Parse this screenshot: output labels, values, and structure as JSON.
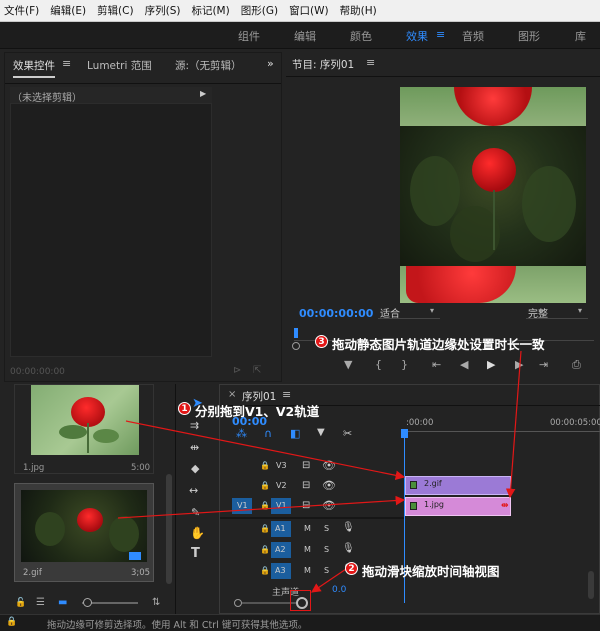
{
  "menu": [
    "文件(F)",
    "编辑(E)",
    "剪辑(C)",
    "序列(S)",
    "标记(M)",
    "图形(G)",
    "窗口(W)",
    "帮助(H)"
  ],
  "workspaces": [
    "组件",
    "编辑",
    "颜色",
    "效果",
    "音频",
    "图形",
    "库"
  ],
  "workspace_active": "效果",
  "effect_controls": {
    "tab1": "效果控件",
    "tab2": "Lumetri 范围",
    "tab3": "源:（无剪辑）",
    "no_clip": "（未选择剪辑）",
    "timecode": "00:00:00:00"
  },
  "program": {
    "title": "节目: 序列01",
    "timecode": "00:00:00:00",
    "fit": "适合",
    "quality": "完整"
  },
  "project": {
    "items": [
      {
        "name": "1.jpg",
        "duration": "5:00"
      },
      {
        "name": "2.gif",
        "duration": "3;05"
      }
    ]
  },
  "timeline": {
    "tab": "序列01",
    "timecode": "00:00",
    "ruler_start": ":00:00",
    "ruler_end": "00:00:05:00",
    "tracks": {
      "v3": "V3",
      "v2": "V2",
      "v1": "V1",
      "v1_source": "V1",
      "a1": "A1",
      "a2": "A2",
      "a3": "A3",
      "master": "主声道",
      "master_value": "0.0",
      "m": "M",
      "s": "S"
    },
    "clips": {
      "gif": "2.gif",
      "jpg": "1.jpg"
    }
  },
  "annotations": [
    {
      "num": "1",
      "text": "分别拖到V1、V2轨道"
    },
    {
      "num": "2",
      "text": "拖动滑块缩放时间轴视图"
    },
    {
      "num": "3",
      "text": "拖动静态图片轨道边缘处设置时长一致"
    }
  ],
  "status": "拖动边缘可修剪选择项。使用 Alt 和 Ctrl 键可获得其他选项。",
  "colors": {
    "accent_blue": "#2f8cff",
    "clip_purple": "#9b7ad6",
    "clip_pink": "#d58ad8",
    "annotation_red": "#e21717"
  }
}
